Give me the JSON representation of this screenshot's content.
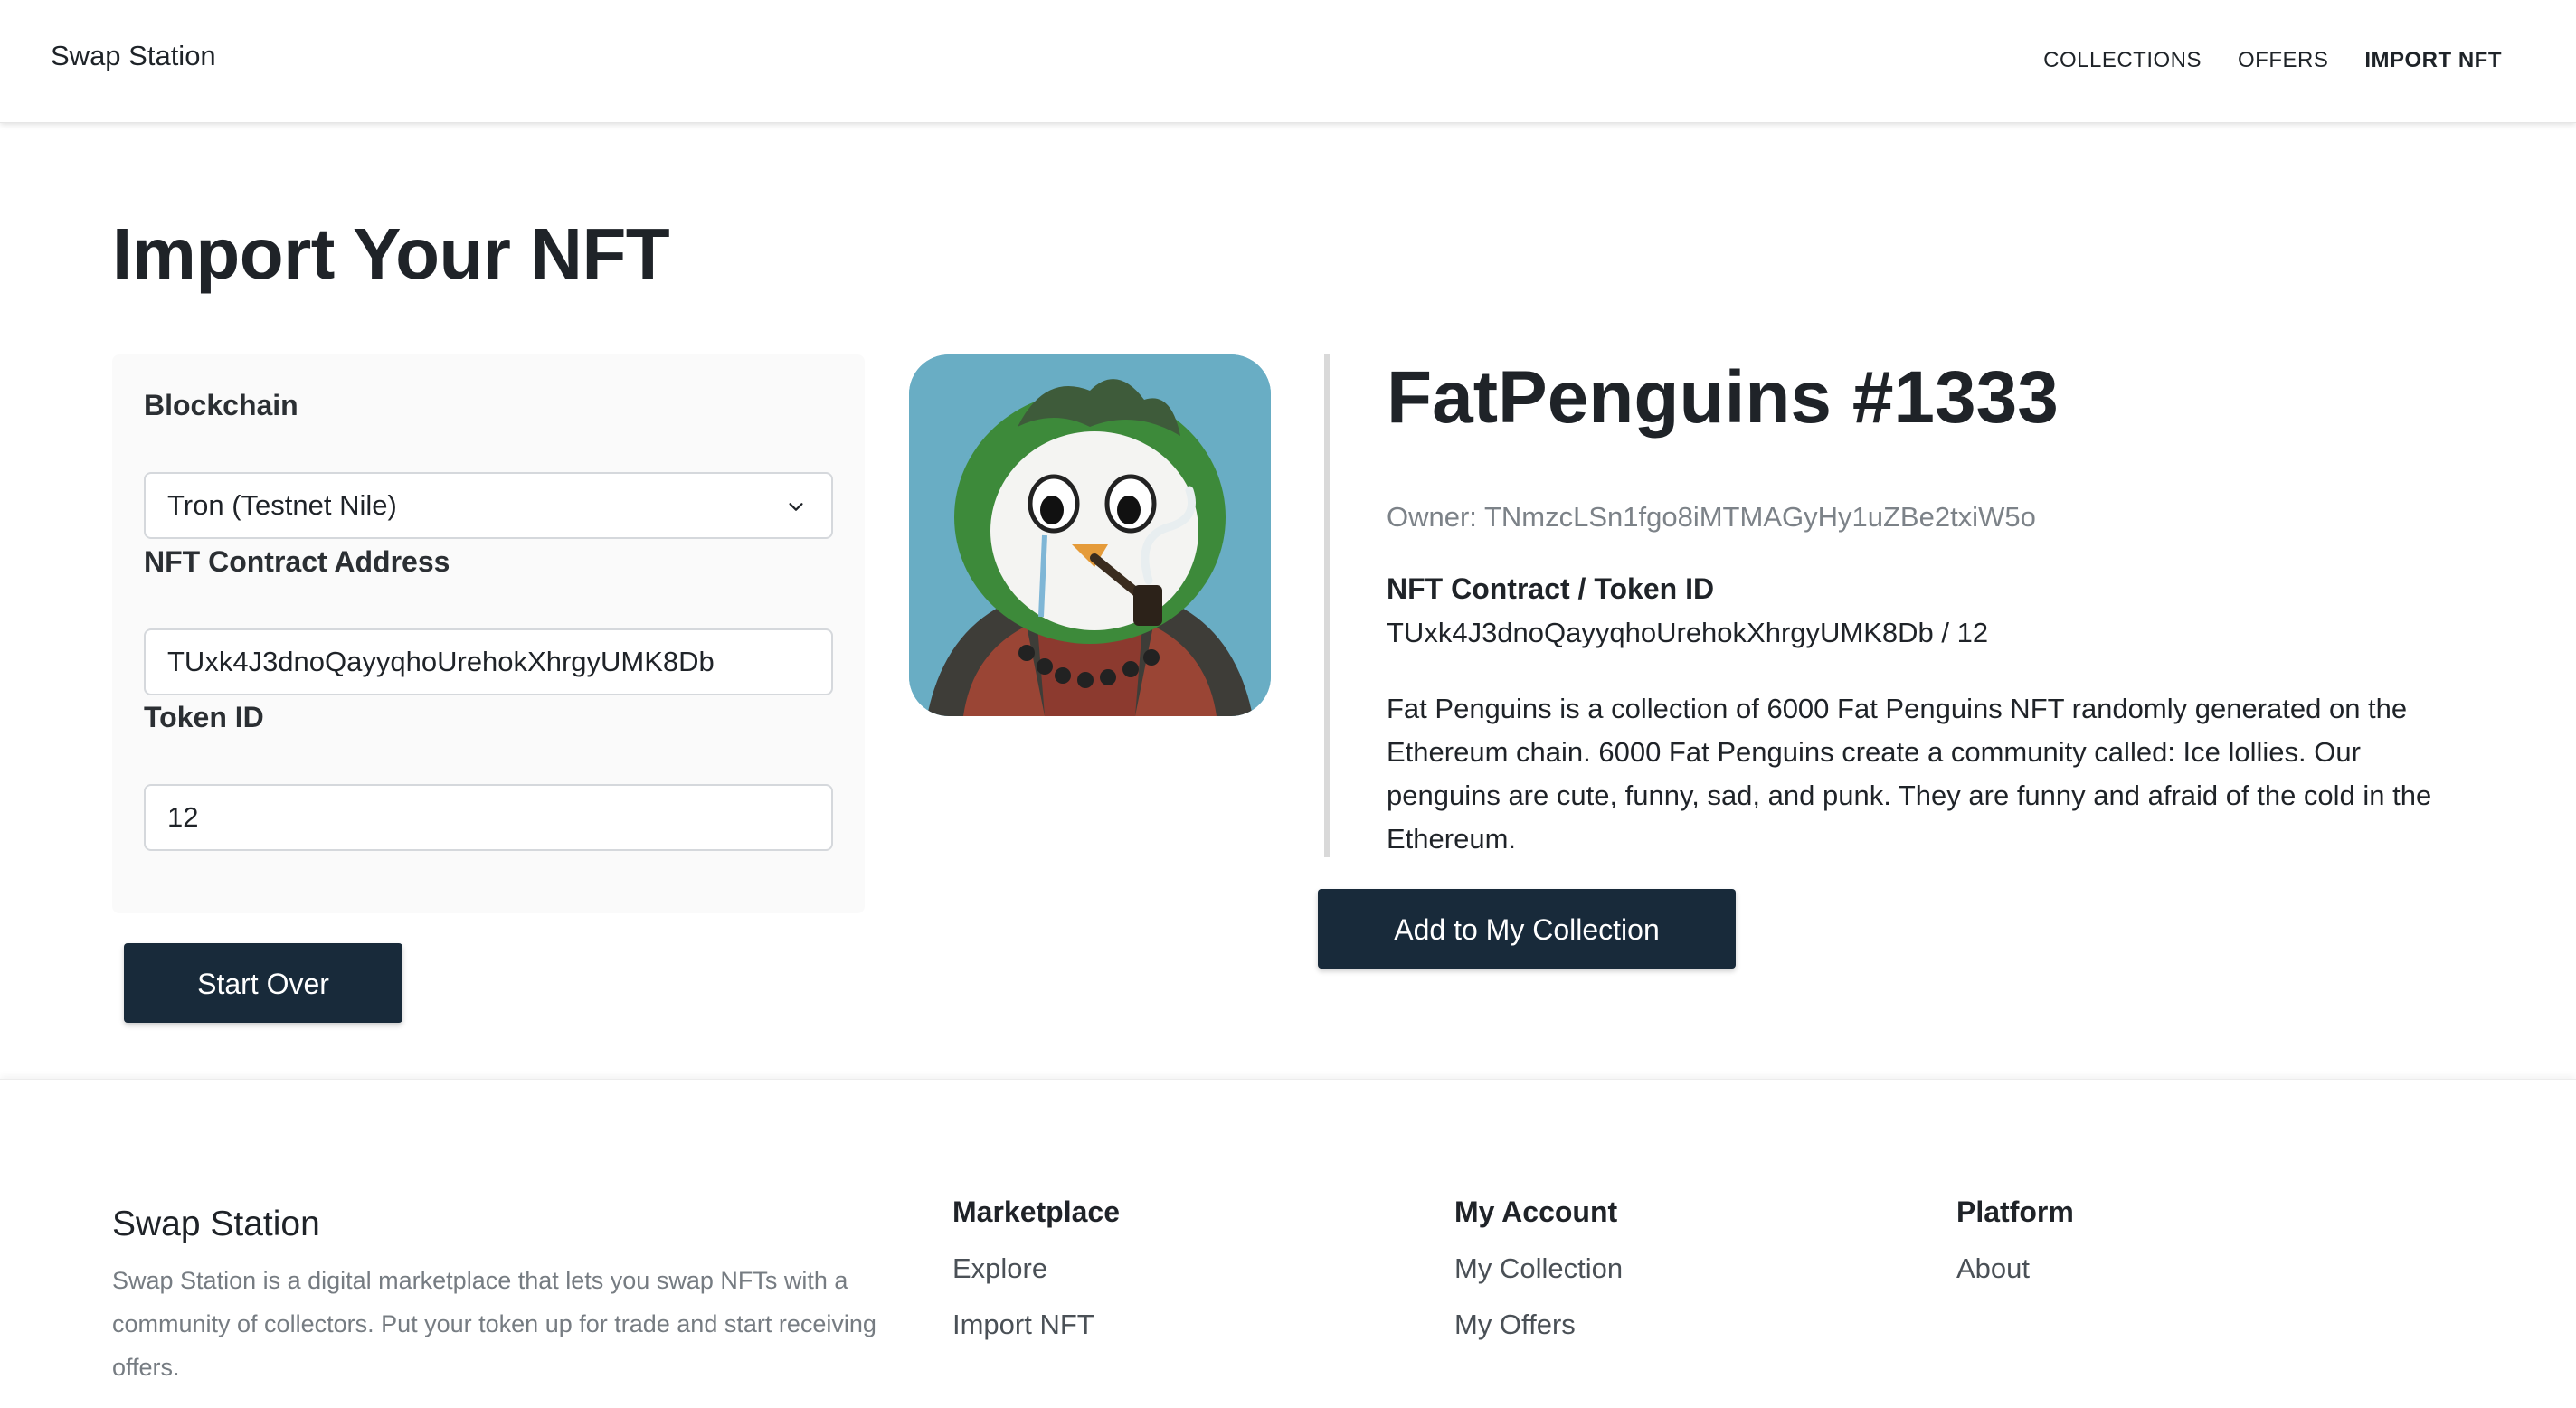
{
  "header": {
    "brand": "Swap Station",
    "nav": [
      {
        "label": "COLLECTIONS"
      },
      {
        "label": "OFFERS"
      },
      {
        "label": "IMPORT NFT",
        "active": true
      }
    ]
  },
  "page": {
    "title": "Import Your NFT"
  },
  "form": {
    "blockchain_label": "Blockchain",
    "blockchain_value": "Tron (Testnet Nile)",
    "contract_label": "NFT Contract Address",
    "contract_value": "TUxk4J3dnoQayyqhoUrehokXhrgyUMK8Db",
    "token_label": "Token ID",
    "token_value": "12",
    "start_over_label": "Start Over"
  },
  "nft": {
    "name": "FatPenguins #1333",
    "owner": "Owner: TNmzcLSn1fgo8iMTMAGyHy1uZBe2txiW5o",
    "contract_heading": "NFT Contract / Token ID",
    "contract_token": "TUxk4J3dnoQayyqhoUrehokXhrgyUMK8Db / 12",
    "description": "Fat Penguins is a collection of 6000 Fat Penguins NFT randomly generated on the Ethereum chain. 6000 Fat Penguins create a community called: Ice lollies. Our penguins are cute, funny, sad, and punk. They are funny and afraid of the cold in the Ethereum.",
    "add_button_label": "Add to My Collection",
    "image_icon": "penguin-illustration"
  },
  "footer": {
    "brand": "Swap Station",
    "description": "Swap Station is a digital marketplace that lets you swap NFTs with a community of collectors. Put your token up for trade and start receiving offers.",
    "columns": [
      {
        "heading": "Marketplace",
        "links": [
          "Explore",
          "Import NFT"
        ]
      },
      {
        "heading": "My Account",
        "links": [
          "My Collection",
          "My Offers"
        ]
      },
      {
        "heading": "Platform",
        "links": [
          "About"
        ]
      }
    ]
  },
  "colors": {
    "primary_button": "#182a3a",
    "image_background": "#69adc4",
    "muted_text": "#7c8288"
  }
}
